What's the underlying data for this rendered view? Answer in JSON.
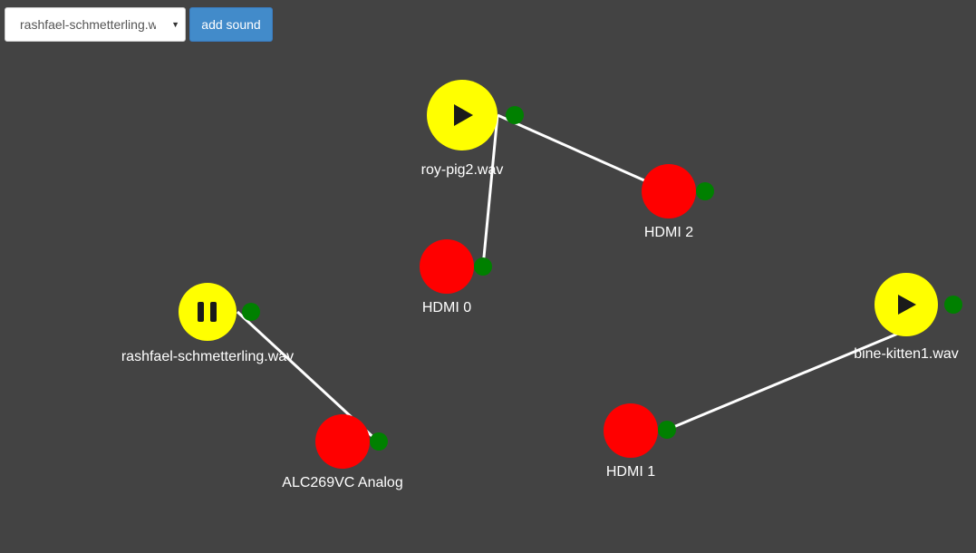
{
  "toolbar": {
    "selected_sound": "rashfael-schmetterling.wav",
    "add_button_label": "add sound"
  },
  "colors": {
    "background": "#434343",
    "sound_node": "#ffff00",
    "output_node": "#ff0000",
    "port": "#008000",
    "edge": "#ffffff"
  },
  "sounds": [
    {
      "id": "roy-pig2",
      "label": "roy-pig2.wav",
      "state": "stopped",
      "icon": "play-icon"
    },
    {
      "id": "rashfael",
      "label": "rashfael-schmetterling.wav",
      "state": "playing",
      "icon": "pause-icon"
    },
    {
      "id": "bine-kitten1",
      "label": "bine-kitten1.wav",
      "state": "stopped",
      "icon": "play-icon"
    }
  ],
  "outputs": [
    {
      "id": "hdmi0",
      "label": "HDMI 0"
    },
    {
      "id": "hdmi1",
      "label": "HDMI 1"
    },
    {
      "id": "hdmi2",
      "label": "HDMI 2"
    },
    {
      "id": "alc269vc",
      "label": "ALC269VC Analog"
    }
  ],
  "connections": [
    {
      "from": "roy-pig2",
      "to": "hdmi2"
    },
    {
      "from": "roy-pig2",
      "to": "hdmi0"
    },
    {
      "from": "rashfael",
      "to": "alc269vc"
    },
    {
      "from": "bine-kitten1",
      "to": "hdmi1"
    }
  ]
}
